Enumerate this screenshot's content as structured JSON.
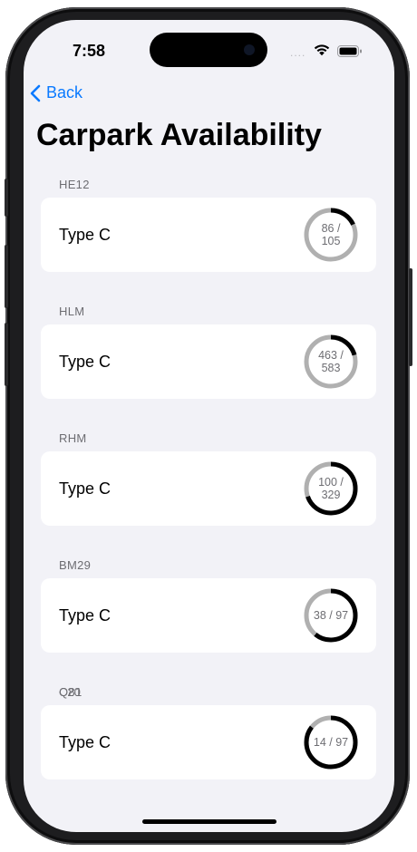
{
  "status_bar": {
    "time": "7:58",
    "signal": "....",
    "icons": [
      "wifi-icon",
      "battery-icon"
    ]
  },
  "nav": {
    "back_label": "Back",
    "back_icon": "chevron-left-icon"
  },
  "page": {
    "title": "Carpark Availability"
  },
  "colors": {
    "accent": "#0a7aff",
    "background": "#f2f2f7",
    "card": "#ffffff",
    "ring_used": "#000000",
    "ring_track": "#b0b0b0",
    "secondary_text": "#6d6d72"
  },
  "carparks": [
    {
      "code": "HE12",
      "type": "Type C",
      "available": 86,
      "total": 105,
      "label_line1": "86 /",
      "label_line2": "105"
    },
    {
      "code": "HLM",
      "type": "Type C",
      "available": 463,
      "total": 583,
      "label_line1": "463 /",
      "label_line2": "583"
    },
    {
      "code": "RHM",
      "type": "Type C",
      "available": 100,
      "total": 329,
      "label_line1": "100 /",
      "label_line2": "329"
    },
    {
      "code": "BM29",
      "type": "Type C",
      "available": 38,
      "total": 97,
      "label_line1": "38 / 97",
      "label_line2": ""
    },
    {
      "code": "Q81",
      "type": "Type C",
      "available": 14,
      "total": 97,
      "label_line1": "14 / 97",
      "label_line2": ""
    }
  ],
  "next_section_header": "C20"
}
